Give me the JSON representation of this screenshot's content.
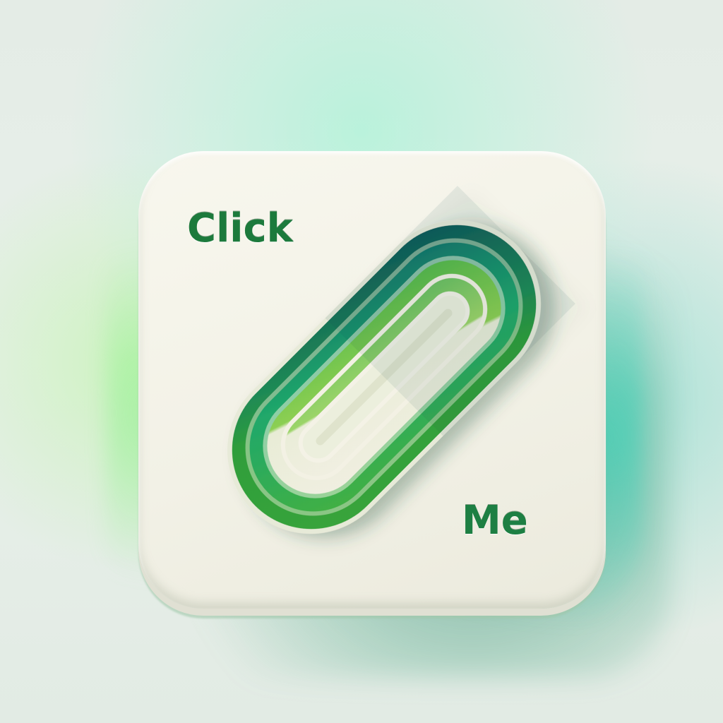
{
  "button": {
    "label_top": "Click",
    "label_bottom": "Me",
    "icon": "paperclip-icon"
  },
  "colors": {
    "label_text": "#1c7a3c",
    "tile_face": "#f4f3e9",
    "accent_green": "#2f9e3a",
    "accent_teal": "#10816a",
    "accent_dark_teal": "#0b4f5a",
    "accent_light_green": "#6cc24a"
  }
}
